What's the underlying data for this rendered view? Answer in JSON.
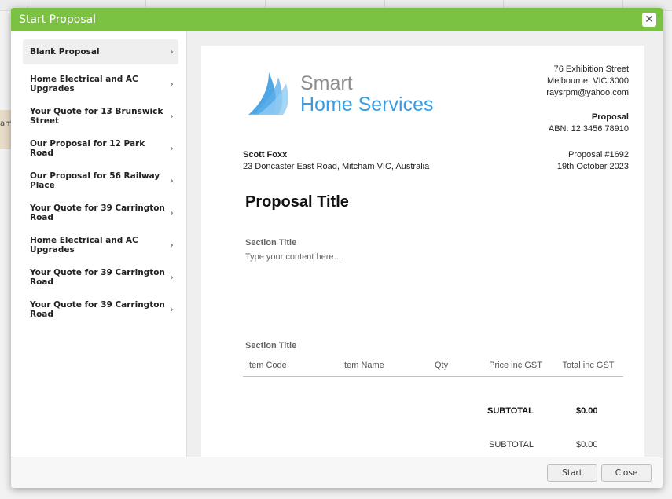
{
  "modal": {
    "title": "Start Proposal",
    "close_icon": "close-icon"
  },
  "background": {
    "partial_text": "am"
  },
  "sidebar": {
    "items": [
      {
        "label": "Blank Proposal",
        "active": true
      },
      {
        "label": "Home Electrical and AC Upgrades"
      },
      {
        "label": "Your Quote for 13 Brunswick Street"
      },
      {
        "label": "Our Proposal for 12 Park Road"
      },
      {
        "label": "Our Proposal for 56 Railway Place"
      },
      {
        "label": "Your Quote for 39 Carrington Road"
      },
      {
        "label": "Home Electrical and AC Upgrades"
      },
      {
        "label": "Your Quote for 39 Carrington Road"
      },
      {
        "label": "Your Quote for 39 Carrington Road"
      }
    ],
    "chevron_icon": "chevron-right-icon"
  },
  "document": {
    "logo": {
      "line1": "Smart",
      "line2": "Home Services",
      "brand_color": "#3b9ce2"
    },
    "company_address": [
      "76 Exhibition Street",
      "Melbourne, VIC  3000",
      "raysrpm@yahoo.com"
    ],
    "doc_type": "Proposal",
    "abn": "ABN: 12 3456 78910",
    "client_name": "Scott Foxx",
    "client_address": "23 Doncaster East Road, Mitcham VIC, Australia",
    "proposal_number": "Proposal #1692",
    "proposal_date": "19th October 2023",
    "proposal_title": "Proposal Title",
    "section1_title": "Section Title",
    "section1_placeholder": "Type your content here...",
    "section2_title": "Section Title",
    "table_headers": [
      "Item Code",
      "Item Name",
      "Qty",
      "Price inc GST",
      "Total inc GST"
    ],
    "subtotal1_label": "SUBTOTAL",
    "subtotal1_value": "$0.00",
    "subtotal2_label": "SUBTOTAL",
    "subtotal2_value": "$0.00"
  },
  "footer": {
    "start_label": "Start",
    "close_label": "Close"
  },
  "colors": {
    "header_green": "#7cc242",
    "logo_blue": "#3b9ce2"
  }
}
